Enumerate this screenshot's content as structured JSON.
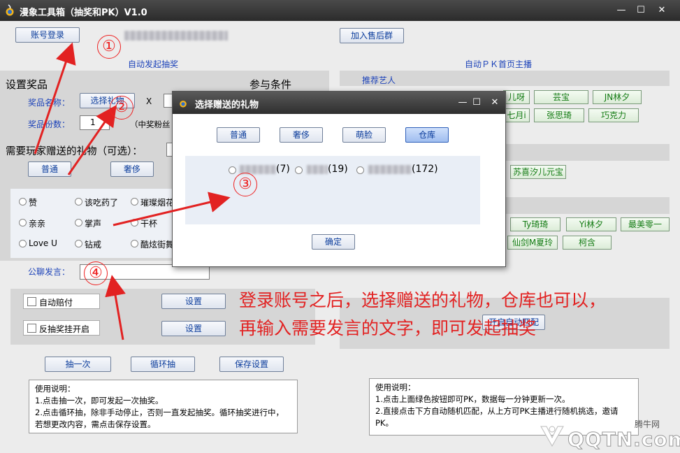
{
  "window": {
    "title": "漫象工具箱（抽奖和PK）V1.0",
    "min": "—",
    "max": "☐",
    "close": "✕"
  },
  "left": {
    "login_button": "账号登录",
    "section_title": "自动发起抽奖",
    "prize_header": "设置奖品",
    "condition_header": "参与条件",
    "prize_name_label": "奖品名称：",
    "choose_gift_button": "选择礼物",
    "times_symbol": "X",
    "prize_count_label": "奖品份数：",
    "prize_count_value": "1",
    "winner_fans_label": "（中奖粉丝",
    "need_gift_label": "需要玩家赠送的礼物（可选）：",
    "tab_normal": "普通",
    "tab_luxury": "奢侈",
    "gifts": [
      "赞",
      "该吃药了",
      "璀璨烟花",
      "亲亲",
      "掌声",
      "干杯",
      "Love U",
      "钻戒",
      "酷炫街舞"
    ],
    "chat_label": "公聊发言：",
    "chat_value": "",
    "auto_accompany": "自动赔付",
    "anti_cheat": "反抽奖挂开启",
    "settings_button_1": "设置",
    "settings_button_2": "设置",
    "draw_once": "抽一次",
    "loop_draw": "循环抽",
    "save_settings": "保存设置",
    "instructions": [
      "使用说明：",
      "1.点击抽一次，即可发起一次抽奖。",
      "2.点击循环抽，除非手动停止，否则一直发起抽奖。循环抽奖进行中，",
      "若想更改内容，需点击保存设置。"
    ]
  },
  "right": {
    "join_group_button": "加入售后群",
    "section_title": "自动ＰＫ首页主播",
    "recommended_label": "推荐艺人",
    "anchors_row1": [
      "儿呀",
      "芸宝",
      "JN林夕"
    ],
    "anchors_row2": [
      "七月i",
      "张思琦",
      "巧克力"
    ],
    "anchors_row3": [
      "苏喜汐儿元宝"
    ],
    "anchors_row4": [
      "Ty琦琦",
      "Yi林夕",
      "最美零一"
    ],
    "anchors_row5": [
      "仙剑M夏玲",
      "柯含"
    ],
    "start_auto_match": "开启自动匹配",
    "instructions": [
      "使用说明：",
      "1.点击上面绿色按钮即可PK，数据每一分钟更新一次。",
      "2.直接点击下方自动随机匹配，从上方可PK主播进行随机挑选，邀请",
      "PK。"
    ]
  },
  "dialog": {
    "title": "选择赠送的礼物",
    "tabs": [
      "普通",
      "奢侈",
      "萌脸",
      "仓库"
    ],
    "items": [
      "(7)",
      "(19)",
      "(172)"
    ],
    "confirm": "确定"
  },
  "annotation": {
    "markers": [
      "①",
      "②",
      "③",
      "④"
    ],
    "text_line1": "登录账号之后，选择赠送的礼物，仓库也可以，",
    "text_line2": "再输入需要发言的文字，即可发起抽奖"
  },
  "watermark": {
    "brand": "QQTN.com",
    "cn": "腾牛网"
  },
  "colors": {
    "accent_blue": "#1d43b9",
    "annotation_red": "#e22222",
    "green_text": "#137b13"
  }
}
